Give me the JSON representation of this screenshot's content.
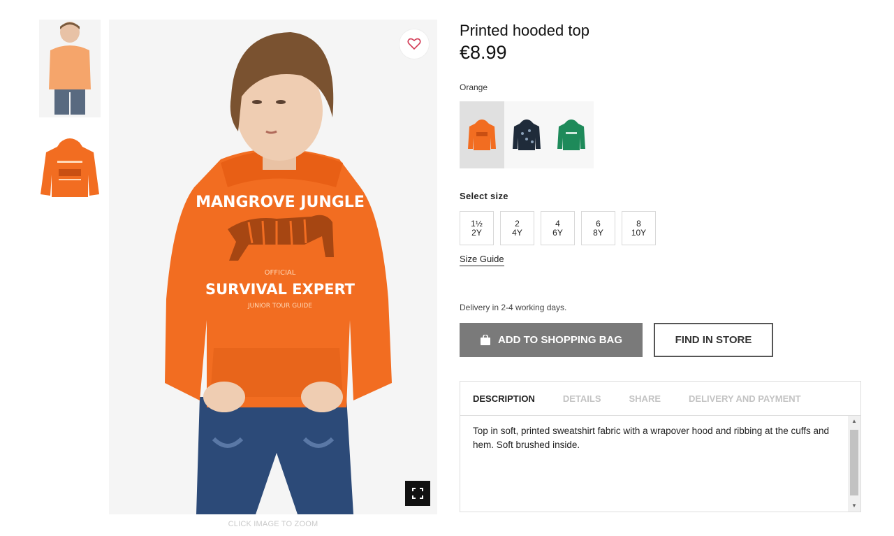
{
  "product": {
    "title": "Printed hooded top",
    "price": "€8.99",
    "selected_color": "Orange",
    "zoom_hint": "CLICK IMAGE TO ZOOM",
    "print_text_line1": "MANGROVE JUNGLE",
    "print_text_line2": "OFFICIAL",
    "print_text_line3": "SURVIVAL EXPERT",
    "print_text_line4": "JUNIOR TOUR GUIDE"
  },
  "colors": {
    "orange": "#f26d21",
    "navy": "#1f2b3a",
    "green": "#1e8a5a",
    "button_gray": "#7a7a7a",
    "jeans": "#2c4a78"
  },
  "swatches": [
    {
      "name": "Orange",
      "color": "#f26d21",
      "icon": "hoodie-icon"
    },
    {
      "name": "Navy",
      "color": "#1f2b3a",
      "icon": "hoodie-icon"
    },
    {
      "name": "Green",
      "color": "#1e8a5a",
      "icon": "hoodie-icon"
    }
  ],
  "size_section": {
    "label": "Select size",
    "sizes": [
      {
        "a": "1½",
        "b": "2Y"
      },
      {
        "a": "2",
        "b": "4Y"
      },
      {
        "a": "4",
        "b": "6Y"
      },
      {
        "a": "6",
        "b": "8Y"
      },
      {
        "a": "8",
        "b": "10Y"
      }
    ],
    "guide_label": "Size Guide"
  },
  "delivery_text": "Delivery in 2-4 working days.",
  "buttons": {
    "add_to_bag": "ADD TO SHOPPING BAG",
    "find_in_store": "FIND IN STORE"
  },
  "tabs": [
    {
      "label": "DESCRIPTION",
      "active": true
    },
    {
      "label": "DETAILS",
      "active": false
    },
    {
      "label": "SHARE",
      "active": false
    },
    {
      "label": "DELIVERY AND PAYMENT",
      "active": false
    }
  ],
  "description": "Top in soft, printed sweatshirt fabric with a wrapover hood and ribbing at the cuffs and hem. Soft brushed inside.",
  "icons": {
    "favorite": "heart-icon",
    "zoom": "expand-icon",
    "bag": "shopping-bag-icon"
  }
}
